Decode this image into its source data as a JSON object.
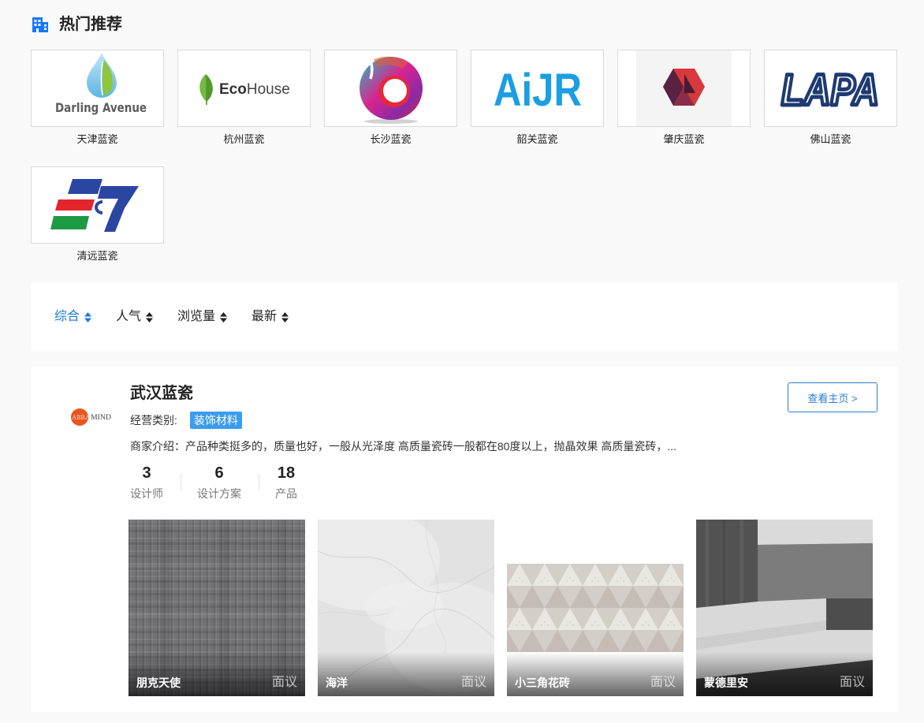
{
  "section": {
    "title": "热门推荐"
  },
  "icons": {
    "section": "building-icon",
    "sort": "sort-icon"
  },
  "brands": [
    {
      "name": "天津蓝瓷",
      "logo_text": "Darling Avenue"
    },
    {
      "name": "杭州蓝瓷",
      "logo_text_bold": "Eco",
      "logo_text": "House"
    },
    {
      "name": "长沙蓝瓷"
    },
    {
      "name": "韶关蓝瓷",
      "logo_text": "AiJR"
    },
    {
      "name": "肇庆蓝瓷"
    },
    {
      "name": "佛山蓝瓷",
      "logo_text": "LAPA"
    },
    {
      "name": "清远蓝瓷"
    }
  ],
  "filters": [
    {
      "label": "综合",
      "active": true
    },
    {
      "label": "人气",
      "active": false
    },
    {
      "label": "浏览量",
      "active": false
    },
    {
      "label": "最新",
      "active": false
    }
  ],
  "store": {
    "name": "武汉蓝瓷",
    "logo_text_a": "ABRA",
    "logo_text_b": "MIND",
    "category_label": "经营类别:",
    "category": "装饰材料",
    "intro": "商家介绍：产品种类挺多的，质量也好，一般从光泽度 高质量瓷砖一般都在80度以上，抛晶效果 高质量瓷砖，...",
    "homepage_button": "查看主页 >",
    "stats": [
      {
        "value": 3,
        "label": "设计师"
      },
      {
        "value": 6,
        "label": "设计方案"
      },
      {
        "value": 18,
        "label": "产品"
      }
    ],
    "products": [
      {
        "name": "朋克天使",
        "price": "面议"
      },
      {
        "name": "海洋",
        "price": "面议"
      },
      {
        "name": "小三角花砖",
        "price": "面议"
      },
      {
        "name": "蒙德里安",
        "price": "面议"
      }
    ]
  },
  "colors": {
    "accent": "#1a7ad8",
    "tag": "#3b9cf0",
    "page_bg": "#f9f9f9"
  }
}
